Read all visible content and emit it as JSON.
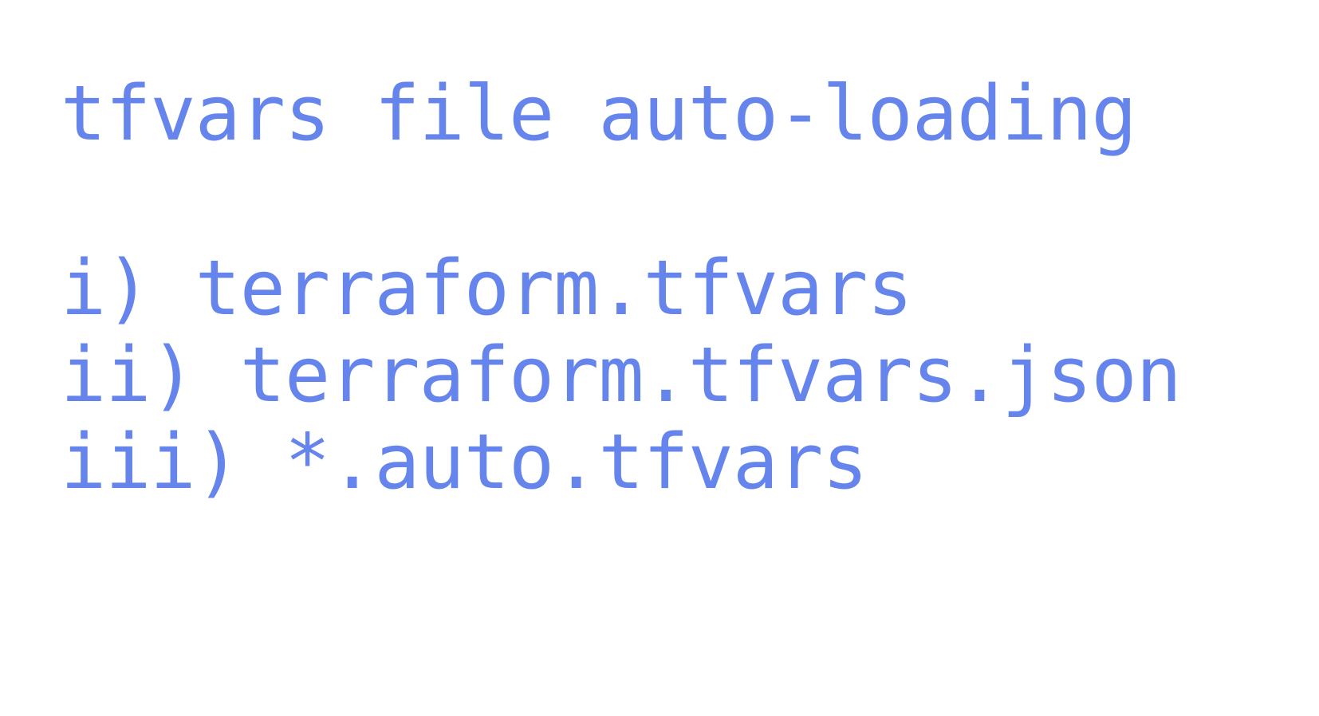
{
  "title": "tfvars file auto-loading",
  "items": [
    "i) terraform.tfvars",
    "ii) terraform.tfvars.json",
    "iii) *.auto.tfvars"
  ],
  "colors": {
    "text": "#6685ec",
    "background": "#ffffff"
  }
}
